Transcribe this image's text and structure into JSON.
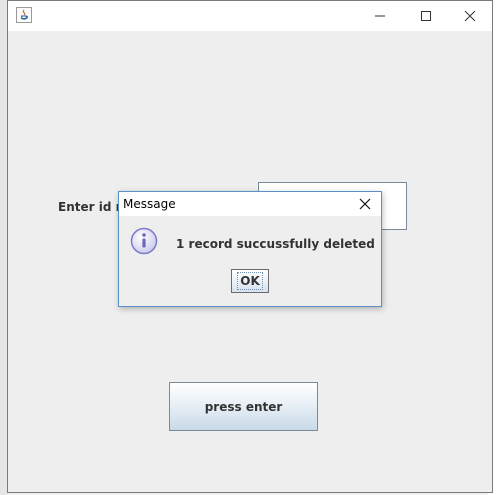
{
  "window": {
    "icon": "java-icon",
    "controls": [
      "minimize-icon",
      "maximize-icon",
      "close-icon"
    ]
  },
  "form": {
    "label": "Enter id no",
    "input_value": "",
    "submit_label": "press enter"
  },
  "dialog": {
    "title": "Message",
    "message": "1 record succussfully deleted",
    "icon": "info-icon",
    "ok_label": "OK"
  },
  "colors": {
    "window_bg": "#eeeeee",
    "dialog_border": "#5b8fc7",
    "info_icon": "#7b7bc9"
  }
}
